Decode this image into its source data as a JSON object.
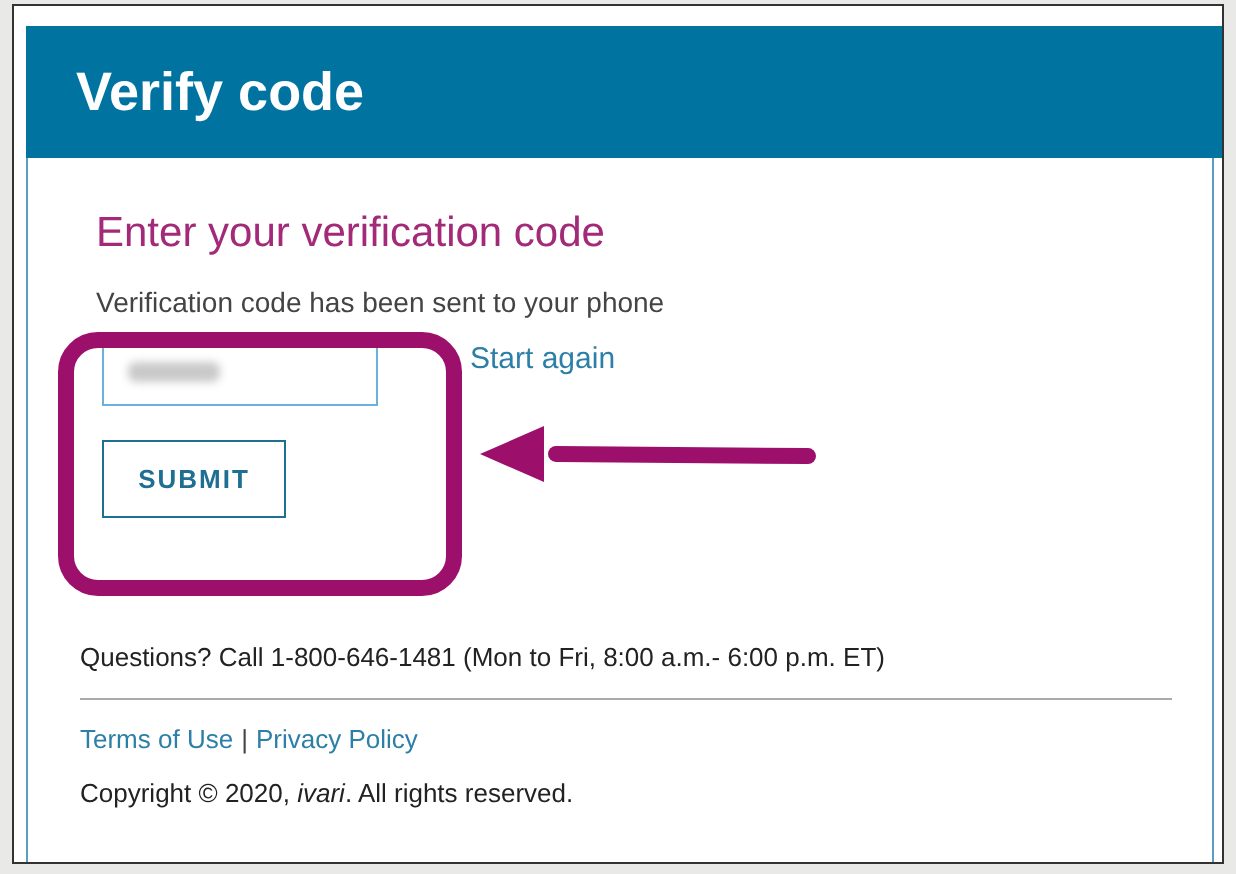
{
  "header": {
    "title": "Verify code"
  },
  "heading": "Enter your verification code",
  "message": "Verification code has been sent to your phone",
  "start_again_link": "Start again",
  "submit_button": "SUBMIT",
  "questions": "Questions? Call 1-800-646-1481 (Mon to Fri, 8:00 a.m.- 6:00 p.m. ET)",
  "footer_links": [
    {
      "label": "Terms of Use"
    },
    {
      "label": "Privacy Policy"
    }
  ],
  "link_separator": "|",
  "copyright": "Copyright © 2020, *ivari*. All rights reserved."
}
